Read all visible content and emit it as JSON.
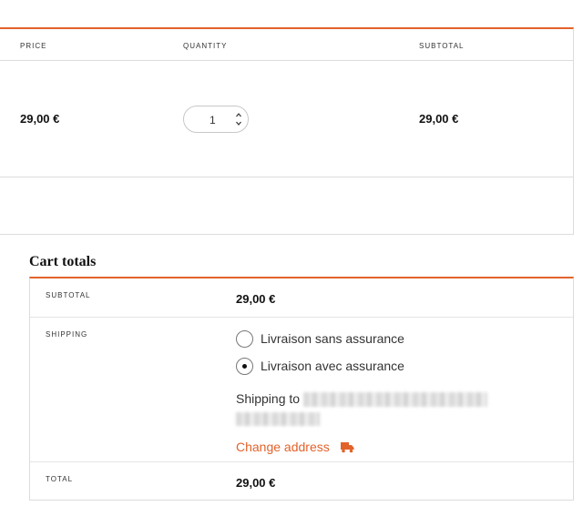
{
  "cart": {
    "columns": {
      "price": "Price",
      "quantity": "Quantity",
      "subtotal": "Subtotal"
    },
    "item": {
      "price": "29,00 €",
      "quantity": "1",
      "subtotal": "29,00 €"
    }
  },
  "totals": {
    "title": "Cart totals",
    "subtotal_label": "Subtotal",
    "subtotal_value": "29,00 €",
    "shipping_label": "Shipping",
    "shipping_options": [
      {
        "label": "Livraison sans assurance",
        "selected": false
      },
      {
        "label": "Livraison avec assurance",
        "selected": true
      }
    ],
    "shipping_to_label": "Shipping to",
    "change_address_label": "Change address",
    "total_label": "Total",
    "total_value": "29,00 €"
  },
  "colors": {
    "accent": "#e2622b",
    "border": "#dcdcdc"
  },
  "icons": {
    "change_address": "truck-icon",
    "quantity_stepper": "chevron-up-down-icon"
  }
}
